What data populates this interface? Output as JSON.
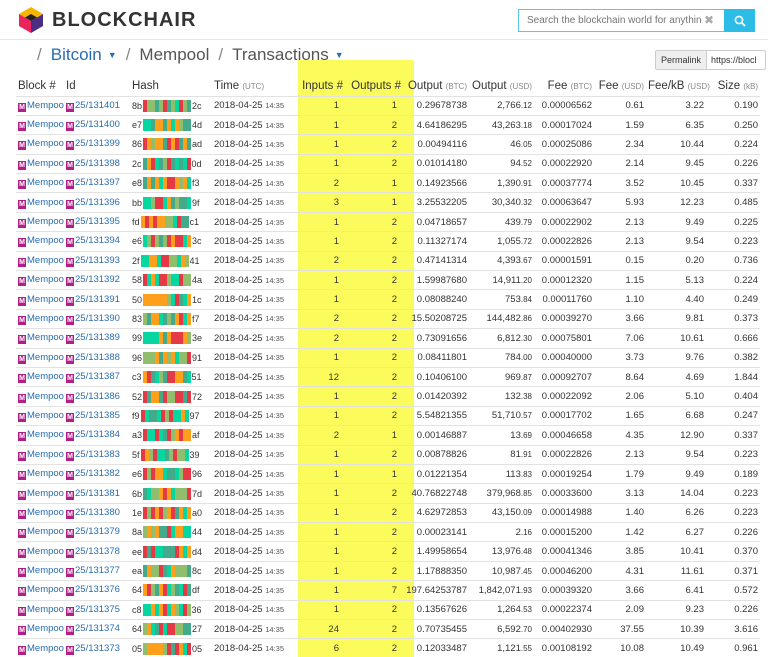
{
  "header": {
    "logo_text": "BLOCKCHAIR",
    "search_placeholder": "Search the blockchain world for anything...",
    "clear_glyph": "✖"
  },
  "breadcrumb": {
    "chain": "Bitcoin",
    "section": "Mempool",
    "page": "Transactions"
  },
  "permalink": {
    "label": "Permalink",
    "value": "https://blocl"
  },
  "table": {
    "headers": {
      "block": "Block #",
      "id": "Id",
      "hash": "Hash",
      "time": "Time",
      "time_unit": "(UTC)",
      "inputs": "Inputs #",
      "outputs": "Outputs #",
      "output_btc": "Output",
      "output_btc_unit": "(BTC)",
      "output_usd": "Output",
      "output_usd_unit": "(USD)",
      "fee": "Fee",
      "fee_unit": "(BTC)",
      "fee_usd": "Fee",
      "fee_usd_unit": "(USD)",
      "fee_kb": "Fee/kB",
      "fee_kb_unit": "(USD)",
      "size": "Size",
      "size_unit": "(kB)"
    },
    "rows": [
      {
        "block": "Mempool",
        "id": "25/131401",
        "hash_start": "8b",
        "hash_end": "2c",
        "date": "2018-04-25",
        "hm": "14:35",
        "inputs": "1",
        "outputs": "1",
        "out_btc": "0.29678738",
        "out_usd_int": "2,766",
        "out_usd_dec": ".12",
        "fee": "0.00006562",
        "fee_usd": "0.61",
        "fee_kb": "3.22",
        "size": "0.190"
      },
      {
        "block": "Mempool",
        "id": "25/131400",
        "hash_start": "e7",
        "hash_end": "4d",
        "date": "2018-04-25",
        "hm": "14:35",
        "inputs": "1",
        "outputs": "2",
        "out_btc": "4.64186295",
        "out_usd_int": "43,263",
        "out_usd_dec": ".18",
        "fee": "0.00017024",
        "fee_usd": "1.59",
        "fee_kb": "6.35",
        "size": "0.250"
      },
      {
        "block": "Mempool",
        "id": "25/131399",
        "hash_start": "86",
        "hash_end": "ad",
        "date": "2018-04-25",
        "hm": "14:35",
        "inputs": "1",
        "outputs": "2",
        "out_btc": "0.00494116",
        "out_usd_int": "46",
        "out_usd_dec": ".05",
        "fee": "0.00025086",
        "fee_usd": "2.34",
        "fee_kb": "10.44",
        "size": "0.224"
      },
      {
        "block": "Mempool",
        "id": "25/131398",
        "hash_start": "2c",
        "hash_end": "0d",
        "date": "2018-04-25",
        "hm": "14:35",
        "inputs": "1",
        "outputs": "2",
        "out_btc": "0.01014180",
        "out_usd_int": "94",
        "out_usd_dec": ".52",
        "fee": "0.00022920",
        "fee_usd": "2.14",
        "fee_kb": "9.45",
        "size": "0.226"
      },
      {
        "block": "Mempool",
        "id": "25/131397",
        "hash_start": "e8",
        "hash_end": "f3",
        "date": "2018-04-25",
        "hm": "14:35",
        "inputs": "2",
        "outputs": "1",
        "out_btc": "0.14923566",
        "out_usd_int": "1,390",
        "out_usd_dec": ".91",
        "fee": "0.00037774",
        "fee_usd": "3.52",
        "fee_kb": "10.45",
        "size": "0.337"
      },
      {
        "block": "Mempool",
        "id": "25/131396",
        "hash_start": "bb",
        "hash_end": "9f",
        "date": "2018-04-25",
        "hm": "14:35",
        "inputs": "3",
        "outputs": "1",
        "out_btc": "3.25532205",
        "out_usd_int": "30,340",
        "out_usd_dec": ".32",
        "fee": "0.00063647",
        "fee_usd": "5.93",
        "fee_kb": "12.23",
        "size": "0.485"
      },
      {
        "block": "Mempool",
        "id": "25/131395",
        "hash_start": "fd",
        "hash_end": "c1",
        "date": "2018-04-25",
        "hm": "14:35",
        "inputs": "1",
        "outputs": "2",
        "out_btc": "0.04718657",
        "out_usd_int": "439",
        "out_usd_dec": ".79",
        "fee": "0.00022902",
        "fee_usd": "2.13",
        "fee_kb": "9.49",
        "size": "0.225"
      },
      {
        "block": "Mempool",
        "id": "25/131394",
        "hash_start": "e6",
        "hash_end": "3c",
        "date": "2018-04-25",
        "hm": "14:35",
        "inputs": "1",
        "outputs": "2",
        "out_btc": "0.11327174",
        "out_usd_int": "1,055",
        "out_usd_dec": ".72",
        "fee": "0.00022826",
        "fee_usd": "2.13",
        "fee_kb": "9.54",
        "size": "0.223"
      },
      {
        "block": "Mempool",
        "id": "25/131393",
        "hash_start": "2f",
        "hash_end": "41",
        "date": "2018-04-25",
        "hm": "14:35",
        "inputs": "2",
        "outputs": "2",
        "out_btc": "0.47141314",
        "out_usd_int": "4,393",
        "out_usd_dec": ".67",
        "fee": "0.00001591",
        "fee_usd": "0.15",
        "fee_kb": "0.20",
        "size": "0.736"
      },
      {
        "block": "Mempool",
        "id": "25/131392",
        "hash_start": "58",
        "hash_end": "4a",
        "date": "2018-04-25",
        "hm": "14:35",
        "inputs": "1",
        "outputs": "2",
        "out_btc": "1.59987680",
        "out_usd_int": "14,911",
        "out_usd_dec": ".20",
        "fee": "0.00012320",
        "fee_usd": "1.15",
        "fee_kb": "5.13",
        "size": "0.224"
      },
      {
        "block": "Mempool",
        "id": "25/131391",
        "hash_start": "50",
        "hash_end": "1c",
        "date": "2018-04-25",
        "hm": "14:35",
        "inputs": "1",
        "outputs": "2",
        "out_btc": "0.08088240",
        "out_usd_int": "753",
        "out_usd_dec": ".84",
        "fee": "0.00011760",
        "fee_usd": "1.10",
        "fee_kb": "4.40",
        "size": "0.249"
      },
      {
        "block": "Mempool",
        "id": "25/131390",
        "hash_start": "83",
        "hash_end": "f7",
        "date": "2018-04-25",
        "hm": "14:35",
        "inputs": "2",
        "outputs": "2",
        "out_btc": "15.50208725",
        "out_usd_int": "144,482",
        "out_usd_dec": ".86",
        "fee": "0.00039270",
        "fee_usd": "3.66",
        "fee_kb": "9.81",
        "size": "0.373"
      },
      {
        "block": "Mempool",
        "id": "25/131389",
        "hash_start": "99",
        "hash_end": "3e",
        "date": "2018-04-25",
        "hm": "14:35",
        "inputs": "2",
        "outputs": "2",
        "out_btc": "0.73091656",
        "out_usd_int": "6,812",
        "out_usd_dec": ".30",
        "fee": "0.00075801",
        "fee_usd": "7.06",
        "fee_kb": "10.61",
        "size": "0.666"
      },
      {
        "block": "Mempool",
        "id": "25/131388",
        "hash_start": "96",
        "hash_end": "91",
        "date": "2018-04-25",
        "hm": "14:35",
        "inputs": "1",
        "outputs": "2",
        "out_btc": "0.08411801",
        "out_usd_int": "784",
        "out_usd_dec": ".00",
        "fee": "0.00040000",
        "fee_usd": "3.73",
        "fee_kb": "9.76",
        "size": "0.382"
      },
      {
        "block": "Mempool",
        "id": "25/131387",
        "hash_start": "c3",
        "hash_end": "51",
        "date": "2018-04-25",
        "hm": "14:35",
        "inputs": "12",
        "outputs": "2",
        "out_btc": "0.10406100",
        "out_usd_int": "969",
        "out_usd_dec": ".87",
        "fee": "0.00092707",
        "fee_usd": "8.64",
        "fee_kb": "4.69",
        "size": "1.844"
      },
      {
        "block": "Mempool",
        "id": "25/131386",
        "hash_start": "52",
        "hash_end": "72",
        "date": "2018-04-25",
        "hm": "14:35",
        "inputs": "1",
        "outputs": "2",
        "out_btc": "0.01420392",
        "out_usd_int": "132",
        "out_usd_dec": ".38",
        "fee": "0.00022092",
        "fee_usd": "2.06",
        "fee_kb": "5.10",
        "size": "0.404"
      },
      {
        "block": "Mempool",
        "id": "25/131385",
        "hash_start": "f9",
        "hash_end": "97",
        "date": "2018-04-25",
        "hm": "14:35",
        "inputs": "1",
        "outputs": "2",
        "out_btc": "5.54821355",
        "out_usd_int": "51,710",
        "out_usd_dec": ".57",
        "fee": "0.00017702",
        "fee_usd": "1.65",
        "fee_kb": "6.68",
        "size": "0.247"
      },
      {
        "block": "Mempool",
        "id": "25/131384",
        "hash_start": "a3",
        "hash_end": "af",
        "date": "2018-04-25",
        "hm": "14:35",
        "inputs": "2",
        "outputs": "1",
        "out_btc": "0.00146887",
        "out_usd_int": "13",
        "out_usd_dec": ".69",
        "fee": "0.00046658",
        "fee_usd": "4.35",
        "fee_kb": "12.90",
        "size": "0.337"
      },
      {
        "block": "Mempool",
        "id": "25/131383",
        "hash_start": "5f",
        "hash_end": "39",
        "date": "2018-04-25",
        "hm": "14:35",
        "inputs": "1",
        "outputs": "2",
        "out_btc": "0.00878826",
        "out_usd_int": "81",
        "out_usd_dec": ".91",
        "fee": "0.00022826",
        "fee_usd": "2.13",
        "fee_kb": "9.54",
        "size": "0.223"
      },
      {
        "block": "Mempool",
        "id": "25/131382",
        "hash_start": "e6",
        "hash_end": "96",
        "date": "2018-04-25",
        "hm": "14:35",
        "inputs": "1",
        "outputs": "1",
        "out_btc": "0.01221354",
        "out_usd_int": "113",
        "out_usd_dec": ".83",
        "fee": "0.00019254",
        "fee_usd": "1.79",
        "fee_kb": "9.49",
        "size": "0.189"
      },
      {
        "block": "Mempool",
        "id": "25/131381",
        "hash_start": "6b",
        "hash_end": "7d",
        "date": "2018-04-25",
        "hm": "14:35",
        "inputs": "1",
        "outputs": "2",
        "out_btc": "40.76822748",
        "out_usd_int": "379,968",
        "out_usd_dec": ".85",
        "fee": "0.00033600",
        "fee_usd": "3.13",
        "fee_kb": "14.04",
        "size": "0.223"
      },
      {
        "block": "Mempool",
        "id": "25/131380",
        "hash_start": "1e",
        "hash_end": "a0",
        "date": "2018-04-25",
        "hm": "14:35",
        "inputs": "1",
        "outputs": "2",
        "out_btc": "4.62972853",
        "out_usd_int": "43,150",
        "out_usd_dec": ".09",
        "fee": "0.00014988",
        "fee_usd": "1.40",
        "fee_kb": "6.26",
        "size": "0.223"
      },
      {
        "block": "Mempool",
        "id": "25/131379",
        "hash_start": "8a",
        "hash_end": "44",
        "date": "2018-04-25",
        "hm": "14:35",
        "inputs": "1",
        "outputs": "2",
        "out_btc": "0.00023141",
        "out_usd_int": "2",
        "out_usd_dec": ".16",
        "fee": "0.00015200",
        "fee_usd": "1.42",
        "fee_kb": "6.27",
        "size": "0.226"
      },
      {
        "block": "Mempool",
        "id": "25/131378",
        "hash_start": "ee",
        "hash_end": "d4",
        "date": "2018-04-25",
        "hm": "14:35",
        "inputs": "1",
        "outputs": "2",
        "out_btc": "1.49958654",
        "out_usd_int": "13,976",
        "out_usd_dec": ".48",
        "fee": "0.00041346",
        "fee_usd": "3.85",
        "fee_kb": "10.41",
        "size": "0.370"
      },
      {
        "block": "Mempool",
        "id": "25/131377",
        "hash_start": "ea",
        "hash_end": "8c",
        "date": "2018-04-25",
        "hm": "14:35",
        "inputs": "1",
        "outputs": "2",
        "out_btc": "1.17888350",
        "out_usd_int": "10,987",
        "out_usd_dec": ".45",
        "fee": "0.00046200",
        "fee_usd": "4.31",
        "fee_kb": "11.61",
        "size": "0.371"
      },
      {
        "block": "Mempool",
        "id": "25/131376",
        "hash_start": "64",
        "hash_end": "df",
        "date": "2018-04-25",
        "hm": "14:35",
        "inputs": "1",
        "outputs": "7",
        "out_btc": "197.64253787",
        "out_usd_int": "1,842,071",
        "out_usd_dec": ".93",
        "fee": "0.00039320",
        "fee_usd": "3.66",
        "fee_kb": "6.41",
        "size": "0.572"
      },
      {
        "block": "Mempool",
        "id": "25/131375",
        "hash_start": "c8",
        "hash_end": "36",
        "date": "2018-04-25",
        "hm": "14:35",
        "inputs": "1",
        "outputs": "2",
        "out_btc": "0.13567626",
        "out_usd_int": "1,264",
        "out_usd_dec": ".53",
        "fee": "0.00022374",
        "fee_usd": "2.09",
        "fee_kb": "9.23",
        "size": "0.226"
      },
      {
        "block": "Mempool",
        "id": "25/131374",
        "hash_start": "64",
        "hash_end": "27",
        "date": "2018-04-25",
        "hm": "14:35",
        "inputs": "24",
        "outputs": "2",
        "out_btc": "0.70735455",
        "out_usd_int": "6,592",
        "out_usd_dec": ".70",
        "fee": "0.00402930",
        "fee_usd": "37.55",
        "fee_kb": "10.39",
        "size": "3.616"
      },
      {
        "block": "Mempool",
        "id": "25/131373",
        "hash_start": "05",
        "hash_end": "05",
        "date": "2018-04-25",
        "hm": "14:35",
        "inputs": "6",
        "outputs": "2",
        "out_btc": "0.12033487",
        "out_usd_int": "1,121",
        "out_usd_dec": ".55",
        "fee": "0.00108192",
        "fee_usd": "10.08",
        "fee_kb": "10.49",
        "size": "0.961"
      }
    ]
  },
  "colors": {
    "accent": "#2bbde6",
    "link": "#2a6db0",
    "highlight": "#fbfb5c",
    "mempool_icon": "#b21f86"
  }
}
